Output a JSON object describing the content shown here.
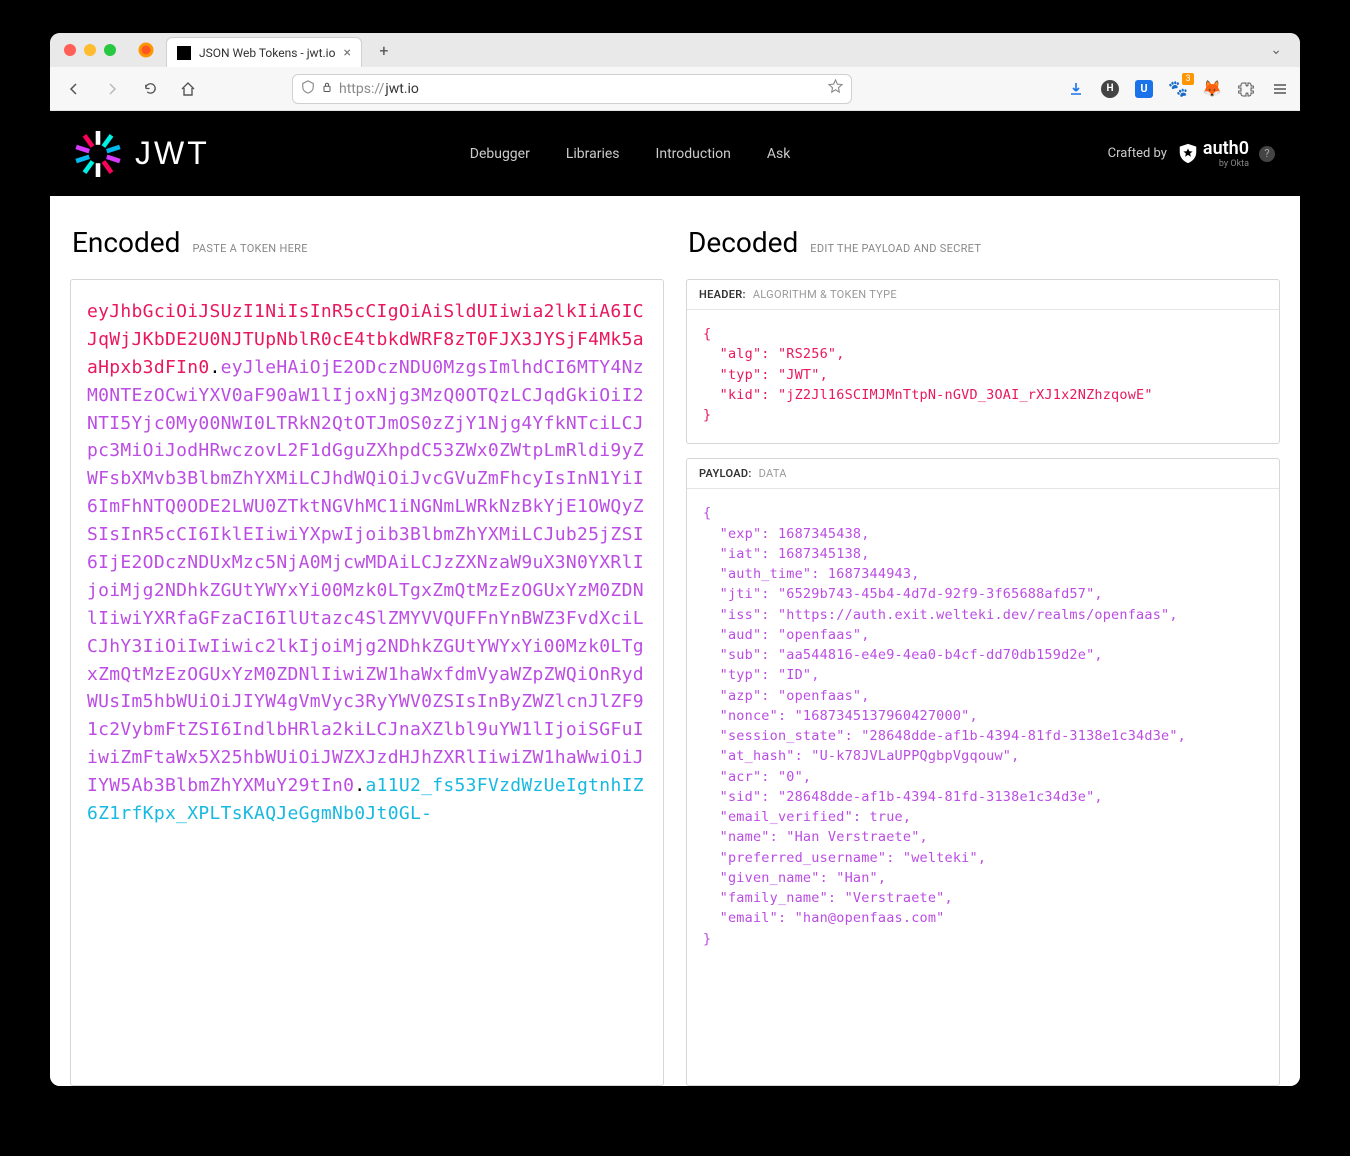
{
  "browser": {
    "tab_title": "JSON Web Tokens - jwt.io",
    "url_scheme": "https://",
    "url_host": "jwt.io",
    "new_tab_plus": "+",
    "tab_dropdown": "⌄",
    "close_glyph": "×",
    "lock_glyph": "🔒",
    "shield_glyph": "⬡",
    "download_glyph": "↓",
    "ext_badge": "3"
  },
  "header": {
    "logo_text": "JWT",
    "nav_debugger": "Debugger",
    "nav_libraries": "Libraries",
    "nav_introduction": "Introduction",
    "nav_ask": "Ask",
    "crafted_by": "Crafted by",
    "auth0": "auth0",
    "by_okta": "by Okta",
    "help": "?"
  },
  "sections": {
    "encoded_title": "Encoded",
    "encoded_sub": "PASTE A TOKEN HERE",
    "decoded_title": "Decoded",
    "decoded_sub": "EDIT THE PAYLOAD AND SECRET",
    "header_label": "HEADER:",
    "header_sub": "ALGORITHM & TOKEN TYPE",
    "payload_label": "PAYLOAD:",
    "payload_sub": "DATA"
  },
  "jwt": {
    "header": "eyJhbGciOiJSUzI1NiIsInR5cCIgOiAiSldUIiwia2lkIiA6ICJqWjJKbDE2U0NJTUpNblR0cE4tbkdWRF8zT0FJX3JYSjF4Mk5aaHpxb3dFIn0",
    "payload": "eyJleHAiOjE2ODczNDU0MzgsImlhdCI6MTY4NzM0NTEzOCwiYXV0aF90aW1lIjoxNjg3MzQ0OTQzLCJqdGkiOiI2NTI5Yjc0My00NWI0LTRkN2QtOTJmOS0zZjY1Njg4YfkNTciLCJpc3MiOiJodHRwczovL2F1dGguZXhpdC53ZWx0ZWtpLmRldi9yZWFsbXMvb3BlbmZhYXMiLCJhdWQiOiJvcGVuZmFhcyIsInN1YiI6ImFhNTQ0ODE2LWU0ZTktNGVhMC1iNGNmLWRkNzBkYjE1OWQyZSIsInR5cCI6IklEIiwiYXpwIjoib3BlbmZhYXMiLCJub25jZSI6IjE2ODczNDUxMzc5NjA0MjcwMDAiLCJzZXNzaW9uX3N0YXRlIjoiMjg2NDhkZGUtYWYxYi00Mzk0LTgxZmQtMzEzOGUxYzM0ZDNlIiwiYXRfaGFzaCI6IlUtazc4SlZMYVVQUFFnYnBWZ3FvdXciLCJhY3IiOiIwIiwic2lkIjoiMjg2NDhkZGUtYWYxYi00Mzk0LTgxZmQtMzEzOGUxYzM0ZDNlIiwiZW1haWxfdmVyaWZpZWQiOnRydWUsIm5hbWUiOiJIYW4gVmVyc3RyYWV0ZSIsInByZWZlcnJlZF91c2VybmFtZSI6IndlbHRla2kiLCJnaXZlbl9uYW1lIjoiSGFuIiwiZmFtaWx5X25hbWUiOiJWZXJzdHJhZXRlIiwiZW1haWwiOiJIYW5Ab3BlbmZhYXMuY29tIn0",
    "signature": "a11U2_fs53FVzdWzUeIgtnhIZ6Z1rfKpx_XPLTsKAQJeGgmNb0Jt0GL-"
  },
  "decoded_header": "{\n  \"alg\": \"RS256\",\n  \"typ\": \"JWT\",\n  \"kid\": \"jZ2Jl16SCIMJMnTtpN-nGVD_3OAI_rXJ1x2NZhzqowE\"\n}",
  "decoded_payload": "{\n  \"exp\": 1687345438,\n  \"iat\": 1687345138,\n  \"auth_time\": 1687344943,\n  \"jti\": \"6529b743-45b4-4d7d-92f9-3f65688afd57\",\n  \"iss\": \"https://auth.exit.welteki.dev/realms/openfaas\",\n  \"aud\": \"openfaas\",\n  \"sub\": \"aa544816-e4e9-4ea0-b4cf-dd70db159d2e\",\n  \"typ\": \"ID\",\n  \"azp\": \"openfaas\",\n  \"nonce\": \"1687345137960427000\",\n  \"session_state\": \"28648dde-af1b-4394-81fd-3138e1c34d3e\",\n  \"at_hash\": \"U-k78JVLaUPPQgbpVgqouw\",\n  \"acr\": \"0\",\n  \"sid\": \"28648dde-af1b-4394-81fd-3138e1c34d3e\",\n  \"email_verified\": true,\n  \"name\": \"Han Verstraete\",\n  \"preferred_username\": \"welteki\",\n  \"given_name\": \"Han\",\n  \"family_name\": \"Verstraete\",\n  \"email\": \"han@openfaas.com\"\n}"
}
